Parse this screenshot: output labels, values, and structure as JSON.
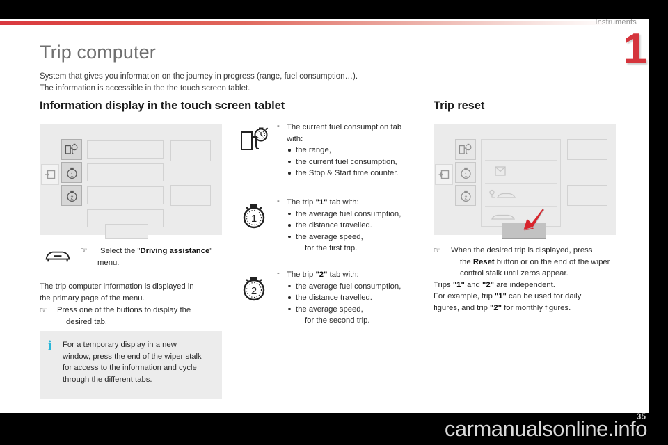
{
  "chapter": {
    "name": "Instruments",
    "number": "1",
    "accent": "#d5343c"
  },
  "title": "Trip computer",
  "intro": {
    "line1": "System that gives you information on the journey in progress (range, fuel consumption…).",
    "line2": "The information is accessible in the the touch screen tablet."
  },
  "sections": {
    "left_heading": "Information display in the touch screen tablet",
    "right_heading": "Trip reset"
  },
  "left": {
    "select_menu": {
      "hand": "☞",
      "text_before": "Select the \"",
      "bold": "Driving assistance",
      "text_after": "\"",
      "line2": "menu."
    },
    "para1_line1": "The trip computer information is displayed in",
    "para1_line2": "the primary page of the menu.",
    "press_hand": "☞",
    "press_line1": "Press one of the buttons to display the",
    "press_line2": "desired tab.",
    "note": {
      "icon": "i",
      "line1": "For a temporary display in a new",
      "line2": "window, press the end of the wiper stalk",
      "line3": "for access to the information and cycle",
      "line4": "through the different tabs."
    }
  },
  "middle": {
    "items": [
      {
        "icon": "fuel-pump-stopwatch-icon",
        "dash": "-",
        "head_line1": "The current fuel consumption tab",
        "head_line2": "with:",
        "bullets": [
          "the range,",
          "the current fuel consumption,",
          "the Stop & Start time counter."
        ]
      },
      {
        "icon": "stopwatch-1-icon",
        "dash": "-",
        "head_prefix": "The trip ",
        "head_bold": "\"1\"",
        "head_suffix": " tab with:",
        "bullets": [
          "the average fuel consumption,",
          "the distance travelled.",
          "the average speed,"
        ],
        "tail": "for the first trip."
      },
      {
        "icon": "stopwatch-2-icon",
        "dash": "-",
        "head_prefix": "The trip ",
        "head_bold": "\"2\"",
        "head_suffix": " tab with:",
        "bullets": [
          "the average fuel consumption,",
          "the distance travelled.",
          "the average speed,"
        ],
        "tail": "for the second trip."
      }
    ]
  },
  "right": {
    "hand": "☞",
    "reset_l1_a": "When the desired trip is displayed, press",
    "reset_l2_a": "the ",
    "reset_l2_bold": "Reset",
    "reset_l2_b": " button or on the end of the wiper",
    "reset_l3": "control stalk until zeros appear.",
    "trips_a": "Trips ",
    "trips_b1": "\"1\"",
    "trips_c": " and ",
    "trips_b2": "\"2\"",
    "trips_d": " are independent.",
    "ex_a": "For example, trip ",
    "ex_b1": "\"1\"",
    "ex_c": " can be used for daily",
    "ex_d": "figures, and trip ",
    "ex_b2": "\"2\"",
    "ex_e": " for monthly figures."
  },
  "footer": {
    "watermark": "carmanualsonline.info",
    "page_number": "35"
  }
}
